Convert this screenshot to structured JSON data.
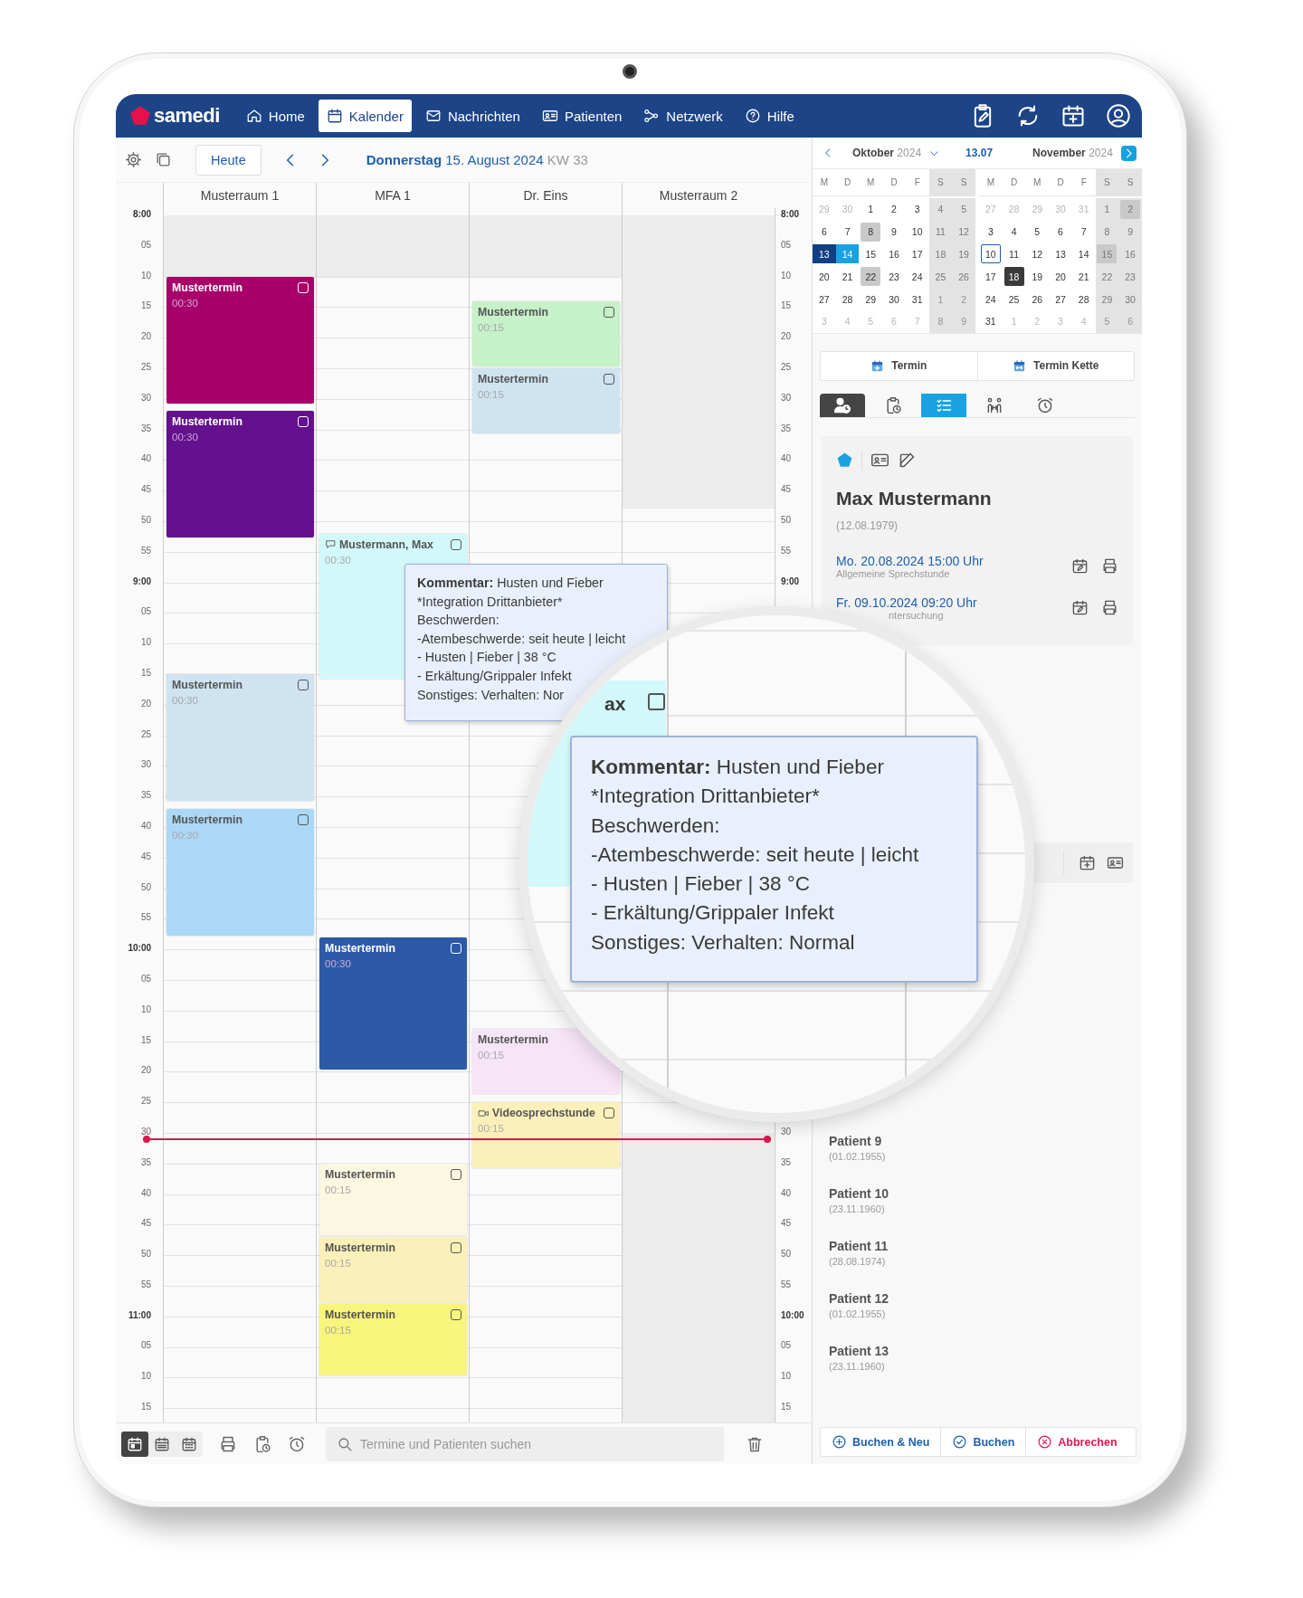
{
  "nav": {
    "logo": "samedi",
    "items": [
      {
        "label": "Home",
        "selected": false
      },
      {
        "label": "Kalender",
        "selected": true
      },
      {
        "label": "Nachrichten",
        "selected": false
      },
      {
        "label": "Patienten",
        "selected": false
      },
      {
        "label": "Netzwerk",
        "selected": false
      },
      {
        "label": "Hilfe",
        "selected": false
      }
    ]
  },
  "toolbar": {
    "today_button": "Heute",
    "weekday": "Donnerstag",
    "date": "15. August 2024",
    "week": "KW 33"
  },
  "calendar": {
    "time_labels": [
      {
        "hour": "8:00",
        "minutes": [
          "05",
          "10",
          "15",
          "20",
          "25",
          "30",
          "35",
          "40",
          "45",
          "50",
          "55"
        ]
      },
      {
        "hour": "9:00",
        "minutes": [
          "05",
          "10",
          "15",
          "20",
          "25",
          "30",
          "35",
          "40",
          "45",
          "50",
          "55"
        ]
      },
      {
        "hour": "10:00",
        "minutes": [
          "05",
          "10",
          "15",
          "20",
          "25",
          "30",
          "35",
          "40",
          "45",
          "50",
          "55"
        ]
      },
      {
        "hour": "11:00",
        "minutes": [
          "05",
          "10",
          "15"
        ]
      }
    ],
    "right_time_labels_top": [
      {
        "hour": "8:00",
        "minutes": [
          "05",
          "10",
          "15",
          "20",
          "25",
          "30",
          "35",
          "40",
          "45",
          "50",
          "55"
        ]
      },
      {
        "hour": "9:00"
      }
    ],
    "right_time_labels_bottom": [
      {
        "minutes": [
          "30",
          "35",
          "40",
          "45",
          "50",
          "55"
        ]
      },
      {
        "hour": "10:00",
        "minutes": [
          "05",
          "10",
          "15"
        ]
      }
    ],
    "columns": [
      {
        "name": "Musterraum 1",
        "events": [
          {
            "title": "Mustertermin",
            "duration": "00:30",
            "color": "#a8006a",
            "kind": "plain",
            "checked": false
          },
          {
            "title": "Mustertermin",
            "duration": "00:30",
            "color": "#63118e",
            "kind": "plain",
            "checked": false
          },
          {
            "title": "Mustertermin",
            "duration": "00:30",
            "color": "#cfe3f1",
            "kind": "plain",
            "checked": false
          },
          {
            "title": "Mustertermin",
            "duration": "00:30",
            "color": "#acd8f7",
            "kind": "plain",
            "checked": false
          }
        ]
      },
      {
        "name": "MFA 1",
        "events": [
          {
            "title": "Mustermann, Max",
            "duration": "00:30",
            "color": "#d3f8fa",
            "kind": "comment",
            "checked": false
          },
          {
            "title": "Mustertermin",
            "duration": "00:30",
            "color": "#2d5aa7",
            "kind": "plain",
            "checked": false
          },
          {
            "title": "Mustertermin",
            "duration": "00:15",
            "color": "#fbf7e1",
            "kind": "plain",
            "checked": false
          },
          {
            "title": "Mustertermin",
            "duration": "00:15",
            "color": "#fbf0b9",
            "kind": "plain",
            "checked": false
          },
          {
            "title": "Mustertermin",
            "duration": "00:15",
            "color": "#f9f57c",
            "kind": "plain",
            "checked": false
          }
        ]
      },
      {
        "name": "Dr. Eins",
        "events": [
          {
            "title": "Mustertermin",
            "duration": "00:15",
            "color": "#c6f1c9",
            "kind": "plain",
            "checked": false
          },
          {
            "title": "Mustertermin",
            "duration": "00:15",
            "color": "#cfe3f1",
            "kind": "plain",
            "checked": false
          },
          {
            "title": "Mustertermin",
            "duration": "00:15",
            "color": "#f6e4f7",
            "kind": "plain"
          },
          {
            "title": "Videosprechstunde",
            "duration": "00:15",
            "color": "#fbf0b9",
            "kind": "video",
            "checked": false
          }
        ]
      },
      {
        "name": "Musterraum 2"
      }
    ]
  },
  "tooltip": {
    "label": "Kommentar:",
    "comment": "Husten und Fieber",
    "lines": [
      "*Integration Drittanbieter*",
      "Beschwerden:",
      "-Atembeschwerde: seit heute | leicht",
      "- Husten | Fieber | 38 °C",
      "- Erkältung/Grippaler Infekt",
      "Sonstiges: Verhalten: Nor"
    ]
  },
  "magnifier": {
    "fragment": "ax",
    "checked": false,
    "label": "Kommentar:",
    "comment": "Husten und Fieber",
    "lines": [
      "*Integration Drittanbieter*",
      "Beschwerden:",
      "-Atembeschwerde: seit heute | leicht",
      "- Husten | Fieber | 38 °C",
      "- Erkältung/Grippaler Infekt",
      "Sonstiges: Verhalten: Normal"
    ]
  },
  "mini_calendar": {
    "today": "13.07",
    "months": [
      {
        "name": "Oktober",
        "year": "2024",
        "weekdays": [
          "M",
          "D",
          "M",
          "D",
          "F",
          "S",
          "S"
        ],
        "weeks": [
          [
            {
              "d": "29",
              "kind": "out"
            },
            {
              "d": "30",
              "kind": "out"
            },
            {
              "d": "1",
              "kind": "day"
            },
            {
              "d": "2",
              "kind": "day"
            },
            {
              "d": "3",
              "kind": "day"
            },
            {
              "d": "4",
              "kind": "day"
            },
            {
              "d": "5",
              "kind": "day"
            }
          ],
          [
            {
              "d": "6",
              "kind": "day"
            },
            {
              "d": "7",
              "kind": "day"
            },
            {
              "d": "8",
              "kind": "booked"
            },
            {
              "d": "9",
              "kind": "day"
            },
            {
              "d": "10",
              "kind": "day"
            },
            {
              "d": "11",
              "kind": "day"
            },
            {
              "d": "12",
              "kind": "day"
            }
          ],
          [
            {
              "d": "13",
              "kind": "selected"
            },
            {
              "d": "14",
              "kind": "range"
            },
            {
              "d": "15",
              "kind": "day"
            },
            {
              "d": "16",
              "kind": "day"
            },
            {
              "d": "17",
              "kind": "day"
            },
            {
              "d": "18",
              "kind": "day"
            },
            {
              "d": "19",
              "kind": "day"
            }
          ],
          [
            {
              "d": "20",
              "kind": "day"
            },
            {
              "d": "21",
              "kind": "day"
            },
            {
              "d": "22",
              "kind": "booked"
            },
            {
              "d": "23",
              "kind": "day"
            },
            {
              "d": "24",
              "kind": "day"
            },
            {
              "d": "25",
              "kind": "day"
            },
            {
              "d": "26",
              "kind": "day"
            }
          ],
          [
            {
              "d": "27",
              "kind": "day"
            },
            {
              "d": "28",
              "kind": "day"
            },
            {
              "d": "29",
              "kind": "day"
            },
            {
              "d": "30",
              "kind": "day"
            },
            {
              "d": "31",
              "kind": "day"
            },
            {
              "d": "1",
              "kind": "out"
            },
            {
              "d": "2",
              "kind": "out"
            }
          ],
          [
            {
              "d": "3",
              "kind": "out"
            },
            {
              "d": "4",
              "kind": "out"
            },
            {
              "d": "5",
              "kind": "out"
            },
            {
              "d": "6",
              "kind": "out"
            },
            {
              "d": "7",
              "kind": "out"
            },
            {
              "d": "8",
              "kind": "out"
            },
            {
              "d": "9",
              "kind": "out"
            }
          ]
        ]
      },
      {
        "name": "November",
        "year": "2024",
        "weekdays": [
          "M",
          "D",
          "M",
          "D",
          "F",
          "S",
          "S"
        ],
        "weeks": [
          [
            {
              "d": "27",
              "kind": "out"
            },
            {
              "d": "28",
              "kind": "out"
            },
            {
              "d": "29",
              "kind": "out"
            },
            {
              "d": "30",
              "kind": "out"
            },
            {
              "d": "31",
              "kind": "out"
            },
            {
              "d": "1",
              "kind": "day"
            },
            {
              "d": "2",
              "kind": "booked"
            }
          ],
          [
            {
              "d": "3",
              "kind": "day"
            },
            {
              "d": "4",
              "kind": "day"
            },
            {
              "d": "5",
              "kind": "day"
            },
            {
              "d": "6",
              "kind": "day"
            },
            {
              "d": "7",
              "kind": "day"
            },
            {
              "d": "8",
              "kind": "day"
            },
            {
              "d": "9",
              "kind": "day"
            }
          ],
          [
            {
              "d": "10",
              "kind": "today"
            },
            {
              "d": "11",
              "kind": "day"
            },
            {
              "d": "12",
              "kind": "day"
            },
            {
              "d": "13",
              "kind": "day"
            },
            {
              "d": "14",
              "kind": "day"
            },
            {
              "d": "15",
              "kind": "booked"
            },
            {
              "d": "16",
              "kind": "day"
            }
          ],
          [
            {
              "d": "17",
              "kind": "day"
            },
            {
              "d": "18",
              "kind": "focus"
            },
            {
              "d": "19",
              "kind": "day"
            },
            {
              "d": "20",
              "kind": "day"
            },
            {
              "d": "21",
              "kind": "day"
            },
            {
              "d": "22",
              "kind": "day"
            },
            {
              "d": "23",
              "kind": "day"
            }
          ],
          [
            {
              "d": "24",
              "kind": "day"
            },
            {
              "d": "25",
              "kind": "day"
            },
            {
              "d": "26",
              "kind": "day"
            },
            {
              "d": "27",
              "kind": "day"
            },
            {
              "d": "28",
              "kind": "day"
            },
            {
              "d": "29",
              "kind": "day"
            },
            {
              "d": "30",
              "kind": "day"
            }
          ],
          [
            {
              "d": "31",
              "kind": "day"
            },
            {
              "d": "1",
              "kind": "out"
            },
            {
              "d": "2",
              "kind": "out"
            },
            {
              "d": "3",
              "kind": "out"
            },
            {
              "d": "4",
              "kind": "out"
            },
            {
              "d": "5",
              "kind": "out"
            },
            {
              "d": "6",
              "kind": "out"
            }
          ]
        ]
      }
    ]
  },
  "booking_buttons": [
    "Termin",
    "Termin Kette"
  ],
  "side_tabs": [
    {
      "selected": true,
      "highlighted": false
    },
    {
      "selected": false,
      "highlighted": false
    },
    {
      "selected": false,
      "highlighted": true
    },
    {
      "selected": false,
      "highlighted": false
    },
    {
      "selected": false,
      "highlighted": false
    }
  ],
  "patient": {
    "name": "Max Mustermann",
    "birth": "(12.08.1979)",
    "appointments": [
      {
        "when": "Mo. 20.08.2024 15:00 Uhr",
        "type": "Allgemeine Sprechstunde",
        "kind": "whole"
      },
      {
        "when": "Fr. 09.10.2024 09:20 Uhr",
        "type": "ntersuchung",
        "kind": "partial"
      }
    ]
  },
  "patients": [
    {
      "name": "Patient 9",
      "birth": "(01.02.1955)"
    },
    {
      "name": "Patient 10",
      "birth": "(23.11.1960)"
    },
    {
      "name": "Patient 11",
      "birth": "(28.08.1974)"
    },
    {
      "name": "Patient 12",
      "birth": "(01.02.1955)"
    },
    {
      "name": "Patient 13",
      "birth": "(23.11.1960)"
    }
  ],
  "actions": [
    {
      "label": "Buchen & Neu",
      "kind": "book_new"
    },
    {
      "label": "Buchen",
      "kind": "book"
    },
    {
      "label": "Abbrechen",
      "kind": "cancel"
    }
  ],
  "bottom_toolbar": {
    "views": [
      {
        "selected": true
      },
      {
        "selected": false
      },
      {
        "selected": false
      }
    ],
    "search_placeholder": "Termine und Patienten suchen"
  }
}
